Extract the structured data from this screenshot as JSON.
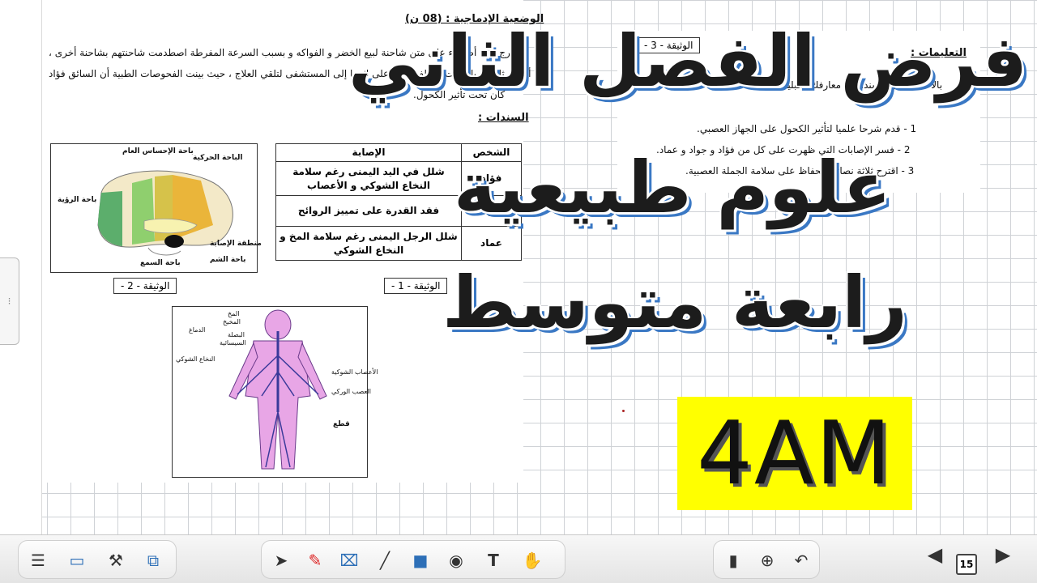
{
  "document": {
    "section_title": "الوضعية الإدماجية : (08 ن)",
    "intro_line1": "خرج ثلاثة أصدقاء على متن شاحنة لبيع الخضر و الفواكه و بسبب السرعة المفرطة اصطدمت شاحنتهم بشاحنة أخرى ،",
    "intro_line2": "أصيب ثلاثتهم بإصابات مختلفة نقلوا على إثرها إلى المستشفى لتلقي العلاج ، حيث بينت الفحوصات الطبية أن السائق فؤاد",
    "intro_line3": "كان تحت تأثير الكحول.",
    "supports_title": "السندات :",
    "table": {
      "headers": [
        "الشخص",
        "الإصابة"
      ],
      "rows": [
        [
          "فؤاد",
          "شلل في اليد اليمنى رغم سلامة النخاع الشوكي و الأعصاب"
        ],
        [
          "جواد",
          "فقد القدرة على تمييز الروائح"
        ],
        [
          "عماد",
          "شلل الرجل اليمنى رغم سلامة المخ و النخاع الشوكي"
        ]
      ]
    },
    "doc1_label": "الوثيقة - 1 -",
    "doc2_label": "الوثيقة - 2 -",
    "doc3_label": "الوثيقة - 3 -",
    "brain_labels": {
      "general_sense": "باحة الإحساس العام",
      "motor": "الباحة الحركية",
      "vision": "باحة الرؤية",
      "injury_zone": "منطقة الإصابة",
      "smell": "باحة الشم",
      "hearing": "باحة السمع"
    },
    "body_labels": {
      "brain": "الدماغ",
      "cerebrum": "المخ",
      "cerebellum": "المخيخ",
      "medulla": "البصلة",
      "pons": "السيسائية",
      "spinal_cord": "النخاع الشوكي",
      "spinal_nerves": "الأعصاب الشوكية",
      "sciatic_nerve": "العصب الوركي",
      "cut": "قطع"
    },
    "instructions_title": "التعليمات :",
    "instructions_intro": "بالاعتماد على السندات و معارفك القبلية",
    "instructions": [
      "1 - قدم شرحا علميا لتأثير الكحول على الجهاز العصبي.",
      "2 - فسر الإصابات التي ظهرت على كل من فؤاد و جواد و عماد.",
      "3 - اقترح ثلاثة نصائح للحفاظ على سلامة الجملة العصبية."
    ]
  },
  "overlay": {
    "line1": "فرض الفصل الثاني",
    "line2": "علوم طبيعية",
    "line3": "رابعة متوسط",
    "badge": "4AM",
    "badge_color": "#ffff00",
    "shadow_color": "#3a78c4"
  },
  "toolbar": {
    "left_tools": [
      "menu-icon",
      "screen-icon",
      "tools-icon",
      "gallery-icon"
    ],
    "center_tools": [
      "select-arrow-icon",
      "pen-icon",
      "eraser-icon",
      "line-icon",
      "shape-icon",
      "fill-icon",
      "text-icon",
      "hand-icon"
    ],
    "right_tools": [
      "delete-icon",
      "capture-icon",
      "undo-icon"
    ],
    "page_number": "15"
  }
}
